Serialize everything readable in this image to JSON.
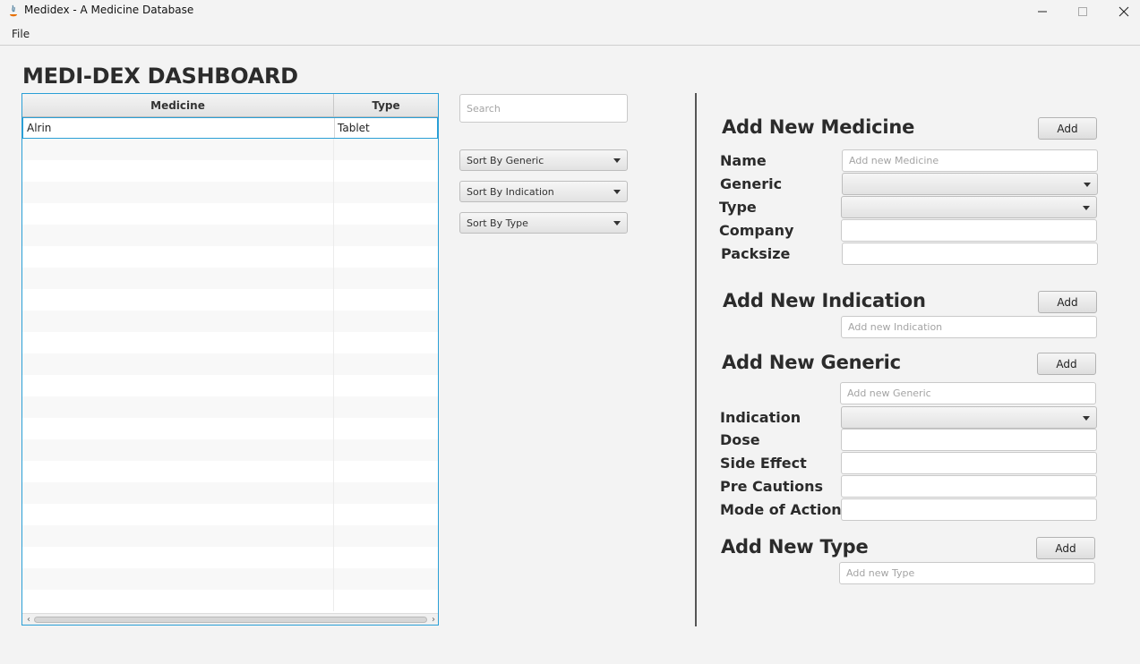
{
  "window": {
    "title": "Medidex - A Medicine Database",
    "minimize_glyph": "—",
    "maximize_glyph": "☐",
    "close_glyph": "✕"
  },
  "menu": {
    "file": "File"
  },
  "dashboard": {
    "title": "MEDI-DEX DASHBOARD"
  },
  "table": {
    "columns": [
      "Medicine",
      "Type"
    ],
    "rows": [
      {
        "medicine": "Alrin",
        "type": "Tablet"
      }
    ]
  },
  "search": {
    "placeholder": "Search",
    "value": ""
  },
  "sort": {
    "generic": "Sort By Generic",
    "indication": "Sort By Indication",
    "type": "Sort By Type"
  },
  "add_medicine": {
    "title": "Add New Medicine",
    "button": "Add",
    "name_label": "Name",
    "name_placeholder": "Add new Medicine",
    "generic_label": "Generic",
    "type_label": "Type",
    "company_label": "Company",
    "packsize_label": "Packsize"
  },
  "add_indication": {
    "title": "Add New Indication",
    "button": "Add",
    "placeholder": "Add new Indication"
  },
  "add_generic": {
    "title": "Add New Generic",
    "button": "Add",
    "placeholder": "Add new Generic",
    "indication_label": "Indication",
    "dose_label": "Dose",
    "side_effect_label": "Side Effect",
    "pre_cautions_label": "Pre Cautions",
    "mode_of_action_label": "Mode of Action"
  },
  "add_type": {
    "title": "Add New Type",
    "button": "Add",
    "placeholder": "Add new Type"
  },
  "colors": {
    "accent": "#2a9fd6",
    "background": "#f3f3f3",
    "divider": "#555555"
  }
}
